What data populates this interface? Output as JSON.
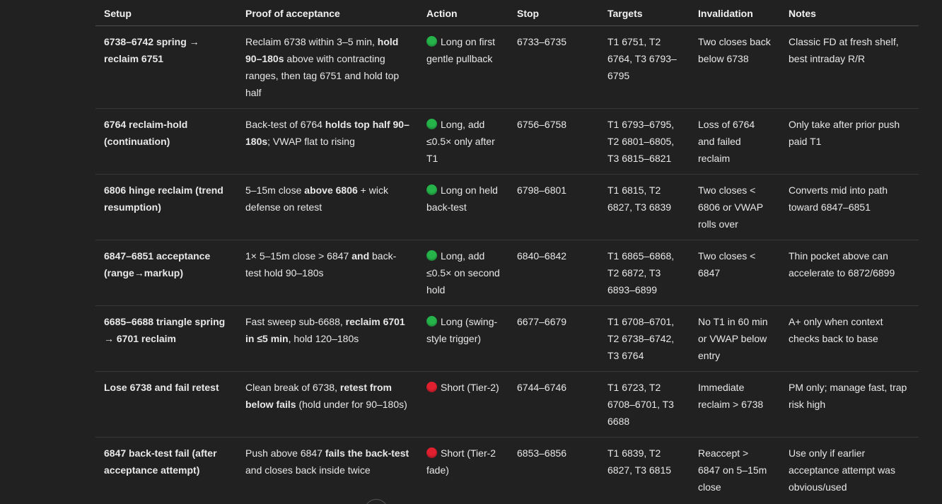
{
  "colors": {
    "background": "#212121",
    "text": "#ececec",
    "long": "#26b34a",
    "short": "#e0202f"
  },
  "table": {
    "headers": [
      "Setup",
      "Proof of acceptance",
      "Action",
      "Stop",
      "Targets",
      "Invalidation",
      "Notes"
    ],
    "rows": [
      {
        "setup": "6738–6742 spring → reclaim 6751",
        "proof": [
          {
            "t": "Reclaim 6738 within 3–5 min, ",
            "b": false
          },
          {
            "t": "hold 90–180s",
            "b": true
          },
          {
            "t": " above with contracting ranges, then tag 6751 and hold top half",
            "b": false
          }
        ],
        "action_icon": "green-circle-icon",
        "action": "Long on first gentle pullback",
        "stop": "6733–6735",
        "targets": "T1 6751, T2 6764, T3 6793–6795",
        "invalidation": "Two closes back below 6738",
        "notes": "Classic FD at fresh shelf, best intraday R/R"
      },
      {
        "setup": "6764 reclaim-hold (continuation)",
        "proof": [
          {
            "t": "Back-test of 6764 ",
            "b": false
          },
          {
            "t": "holds top half 90–180s",
            "b": true
          },
          {
            "t": "; VWAP flat to rising",
            "b": false
          }
        ],
        "action_icon": "green-circle-icon",
        "action": "Long, add ≤0.5× only after T1",
        "stop": "6756–6758",
        "targets": "T1 6793–6795, T2 6801–6805, T3 6815–6821",
        "invalidation": "Loss of 6764 and failed reclaim",
        "notes": "Only take after prior push paid T1"
      },
      {
        "setup": "6806 hinge reclaim (trend resumption)",
        "proof": [
          {
            "t": "5–15m close ",
            "b": false
          },
          {
            "t": "above 6806",
            "b": true
          },
          {
            "t": " + wick defense on retest",
            "b": false
          }
        ],
        "action_icon": "green-circle-icon",
        "action": "Long on held back-test",
        "stop": "6798–6801",
        "targets": "T1 6815, T2 6827, T3 6839",
        "invalidation": "Two closes < 6806 or VWAP rolls over",
        "notes": "Converts mid into path toward 6847–6851"
      },
      {
        "setup": "6847–6851 acceptance (range→markup)",
        "proof": [
          {
            "t": "1× 5–15m close > 6847 ",
            "b": false
          },
          {
            "t": "and",
            "b": true
          },
          {
            "t": " back-test hold 90–180s",
            "b": false
          }
        ],
        "action_icon": "green-circle-icon",
        "action": "Long, add ≤0.5× on second hold",
        "stop": "6840–6842",
        "targets": "T1 6865–6868, T2 6872, T3 6893–6899",
        "invalidation": "Two closes < 6847",
        "notes": "Thin pocket above can accelerate to 6872/6899"
      },
      {
        "setup": "6685–6688 triangle spring → 6701 reclaim",
        "proof": [
          {
            "t": "Fast sweep sub-6688, ",
            "b": false
          },
          {
            "t": "reclaim 6701 in ≤5 min",
            "b": true
          },
          {
            "t": ", hold 120–180s",
            "b": false
          }
        ],
        "action_icon": "green-circle-icon",
        "action": "Long (swing-style trigger)",
        "stop": "6677–6679",
        "targets": "T1 6708–6701, T2 6738–6742, T3 6764",
        "invalidation": "No T1 in 60 min or VWAP below entry",
        "notes": "A+ only when context checks back to base"
      },
      {
        "setup": "Lose 6738 and fail retest",
        "proof": [
          {
            "t": "Clean break of 6738, ",
            "b": false
          },
          {
            "t": "retest from below fails",
            "b": true
          },
          {
            "t": " (hold under for 90–180s)",
            "b": false
          }
        ],
        "action_icon": "red-circle-icon",
        "action": "Short (Tier-2)",
        "stop": "6744–6746",
        "targets": "T1 6723, T2 6708–6701, T3 6688",
        "invalidation": "Immediate reclaim > 6738",
        "notes": "PM only; manage fast, trap risk high"
      },
      {
        "setup": "6847 back-test fail (after acceptance attempt)",
        "proof": [
          {
            "t": "Push above 6847 ",
            "b": false
          },
          {
            "t": "fails the back-test",
            "b": true
          },
          {
            "t": " and closes back inside twice",
            "b": false
          }
        ],
        "action_icon": "red-circle-icon",
        "action": "Short (Tier-2 fade)",
        "stop": "6853–6856",
        "targets": "T1 6839, T2 6827, T3 6815",
        "invalidation": "Reaccept > 6847 on 5–15m close",
        "notes": "Use only if earlier acceptance attempt was obvious/used"
      }
    ]
  }
}
